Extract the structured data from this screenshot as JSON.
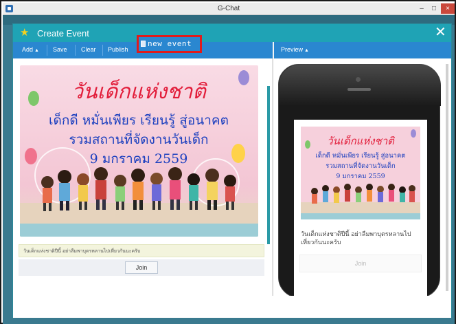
{
  "os_window": {
    "title": "G-Chat",
    "minimize": "–",
    "maximize": "□",
    "close": "×"
  },
  "dialog": {
    "title": "Create Event",
    "close": "✕"
  },
  "toolbar": {
    "add_label": "Add",
    "save_label": "Save",
    "clear_label": "Clear",
    "publish_label": "Publish",
    "event_name": "new event"
  },
  "preview": {
    "menu_label": "Preview"
  },
  "event": {
    "banner": {
      "headline": "วันเด็กแห่งชาติ",
      "line1": "เด็กดี หมั่นเพียร เรียนรู้ สู่อนาคต",
      "line2": "รวมสถานที่จัดงานวันเด็ก",
      "line3": "9 มกราคม 2559"
    },
    "caption": "วันเด็กแห่งชาติปีนี้ อย่าลืมพาบุตรหลานไปเที่ยวกันนะครับ",
    "phone_caption": "วันเด็กแห่งชาติปีนี้ อย่าลืมพาบุตรหลานไปเที่ยวกันนะครับ",
    "join_label": "Join"
  },
  "colors": {
    "dialog_header": "#1fa3b5",
    "toolbar": "#2a87d0",
    "highlight_box": "#e11b1b",
    "headline": "#e21d3a",
    "banner_text": "#1b3fbf",
    "banner_bg": "#f5c9d6"
  },
  "icons": {
    "title_icon": "star-icon",
    "event_icon": "document-icon"
  }
}
